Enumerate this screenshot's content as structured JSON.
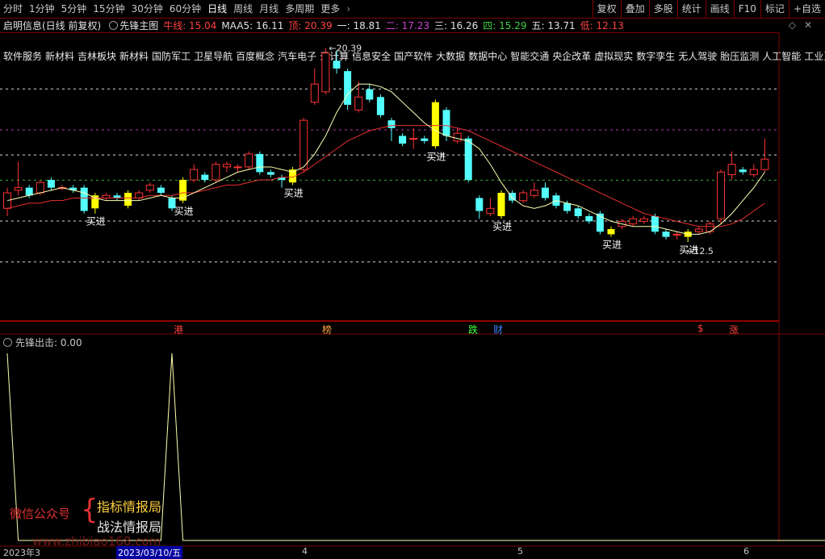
{
  "toolbar": {
    "timeframes": [
      "分时",
      "1分钟",
      "5分钟",
      "15分钟",
      "30分钟",
      "60分钟",
      "日线",
      "周线",
      "月线",
      "多周期",
      "更多"
    ],
    "more_arrow": "›",
    "active_index": 6,
    "right_tools": [
      "复权",
      "叠加",
      "多股",
      "统计",
      "画线",
      "F10",
      "标记",
      "+自选"
    ]
  },
  "info": {
    "stock": "启明信息(日线 前复权)",
    "indicator_name": "先锋主图",
    "items": [
      {
        "label": "牛线: ",
        "value": "15.04",
        "color": "#ff4040"
      },
      {
        "label": "MAA5: ",
        "value": "16.11",
        "color": "#e0e0e0"
      },
      {
        "label": "顶: ",
        "value": "20.39",
        "color": "#ff4040"
      },
      {
        "label": "一: ",
        "value": "18.81",
        "color": "#e0e0e0"
      },
      {
        "label": "二: ",
        "value": "17.23",
        "color": "#d040d0"
      },
      {
        "label": "三: ",
        "value": "16.26",
        "color": "#e0e0e0"
      },
      {
        "label": "四: ",
        "value": "15.29",
        "color": "#40d040"
      },
      {
        "label": "五: ",
        "value": "13.71",
        "color": "#e0e0e0"
      },
      {
        "label": "低: ",
        "value": "12.13",
        "color": "#ff4040"
      }
    ]
  },
  "concepts": [
    "软件服务",
    "新材料",
    "吉林板块",
    "新材料",
    "国防军工",
    "卫星导航",
    "百度概念",
    "汽车电子",
    "云计算",
    "信息安全",
    "国产软件",
    "大数据",
    "数据中心",
    "智能交通",
    "央企改革",
    "虚拟现实",
    "数字孪生",
    "无人驾驶",
    "胎压监测",
    "人工智能",
    "工业互联"
  ],
  "colors": {
    "up": "#ff3232",
    "down": "#54ffff",
    "signal": "#ffff00",
    "ma5": "#ffffb0",
    "ma": "#ff3a3a",
    "bg": "#000000"
  },
  "chart_data": [
    {
      "type": "candlestick",
      "title": "先锋主图",
      "ylim": [
        11.5,
        21.0
      ],
      "levels": [
        {
          "name": "顶",
          "value": 20.39,
          "color": "#ffffff"
        },
        {
          "name": "一",
          "value": 18.81,
          "color": "#ffffff"
        },
        {
          "name": "二",
          "value": 17.23,
          "color": "#d040d0"
        },
        {
          "name": "三",
          "value": 16.26,
          "color": "#ffffff"
        },
        {
          "name": "四",
          "value": 15.29,
          "color": "#40d040"
        },
        {
          "name": "五",
          "value": 13.71,
          "color": "#ffffff"
        },
        {
          "name": "低",
          "value": 12.13,
          "color": "#ffffff"
        }
      ],
      "high_label": "20.39",
      "low_label": "12.5",
      "candles": [
        {
          "o": 14.2,
          "c": 14.8,
          "h": 15.0,
          "l": 13.9,
          "s": 0
        },
        {
          "o": 14.9,
          "c": 15.0,
          "h": 16.0,
          "l": 14.7,
          "s": 0
        },
        {
          "o": 15.0,
          "c": 14.7,
          "h": 15.1,
          "l": 14.6,
          "s": 0
        },
        {
          "o": 14.8,
          "c": 15.2,
          "h": 15.3,
          "l": 14.7,
          "s": 0
        },
        {
          "o": 15.3,
          "c": 15.0,
          "h": 15.4,
          "l": 14.9,
          "s": 0
        },
        {
          "o": 15.0,
          "c": 15.0,
          "h": 15.1,
          "l": 14.9,
          "s": 0
        },
        {
          "o": 15.0,
          "c": 14.9,
          "h": 15.1,
          "l": 14.8,
          "s": 0
        },
        {
          "o": 15.0,
          "c": 14.1,
          "h": 15.1,
          "l": 14.0,
          "s": 0
        },
        {
          "o": 14.7,
          "c": 14.2,
          "h": 14.8,
          "l": 14.0,
          "s": 1
        },
        {
          "o": 14.6,
          "c": 14.7,
          "h": 14.8,
          "l": 14.5,
          "s": 0
        },
        {
          "o": 14.7,
          "c": 14.6,
          "h": 14.8,
          "l": 14.5,
          "s": 0
        },
        {
          "o": 14.8,
          "c": 14.3,
          "h": 14.9,
          "l": 14.2,
          "s": 1
        },
        {
          "o": 14.6,
          "c": 14.8,
          "h": 14.9,
          "l": 14.5,
          "s": 0
        },
        {
          "o": 14.9,
          "c": 15.1,
          "h": 15.2,
          "l": 14.8,
          "s": 0
        },
        {
          "o": 15.0,
          "c": 14.8,
          "h": 15.1,
          "l": 14.7,
          "s": 0
        },
        {
          "o": 14.6,
          "c": 14.2,
          "h": 14.7,
          "l": 14.1,
          "s": 0
        },
        {
          "o": 15.3,
          "c": 14.5,
          "h": 15.4,
          "l": 14.4,
          "s": 1
        },
        {
          "o": 15.3,
          "c": 15.7,
          "h": 15.9,
          "l": 15.2,
          "s": 0
        },
        {
          "o": 15.5,
          "c": 15.3,
          "h": 15.6,
          "l": 15.2,
          "s": 0
        },
        {
          "o": 15.3,
          "c": 15.9,
          "h": 16.0,
          "l": 15.2,
          "s": 0
        },
        {
          "o": 15.8,
          "c": 15.9,
          "h": 16.0,
          "l": 15.6,
          "s": 0
        },
        {
          "o": 15.8,
          "c": 15.8,
          "h": 15.9,
          "l": 15.6,
          "s": 0
        },
        {
          "o": 15.8,
          "c": 16.3,
          "h": 16.4,
          "l": 15.7,
          "s": 0
        },
        {
          "o": 16.3,
          "c": 15.6,
          "h": 16.4,
          "l": 15.5,
          "s": 0
        },
        {
          "o": 15.6,
          "c": 15.5,
          "h": 15.7,
          "l": 15.4,
          "s": 0
        },
        {
          "o": 15.4,
          "c": 15.3,
          "h": 15.5,
          "l": 15.0,
          "s": 0
        },
        {
          "o": 15.7,
          "c": 15.2,
          "h": 15.8,
          "l": 15.1,
          "s": 1
        },
        {
          "o": 15.7,
          "c": 17.6,
          "h": 17.7,
          "l": 15.6,
          "s": 0
        },
        {
          "o": 18.3,
          "c": 19.0,
          "h": 19.6,
          "l": 18.2,
          "s": 0
        },
        {
          "o": 18.7,
          "c": 20.2,
          "h": 20.39,
          "l": 18.6,
          "s": 0
        },
        {
          "o": 19.9,
          "c": 19.6,
          "h": 20.3,
          "l": 19.4,
          "s": 0
        },
        {
          "o": 19.5,
          "c": 18.2,
          "h": 19.6,
          "l": 18.0,
          "s": 0
        },
        {
          "o": 18.0,
          "c": 18.5,
          "h": 19.1,
          "l": 17.9,
          "s": 0
        },
        {
          "o": 18.8,
          "c": 18.4,
          "h": 19.0,
          "l": 18.3,
          "s": 0
        },
        {
          "o": 18.5,
          "c": 17.8,
          "h": 18.6,
          "l": 17.7,
          "s": 0
        },
        {
          "o": 17.6,
          "c": 17.3,
          "h": 17.7,
          "l": 16.8,
          "s": 0
        },
        {
          "o": 17.0,
          "c": 16.7,
          "h": 17.1,
          "l": 16.6,
          "s": 0
        },
        {
          "o": 16.9,
          "c": 16.9,
          "h": 17.3,
          "l": 16.5,
          "s": 0
        },
        {
          "o": 16.9,
          "c": 16.8,
          "h": 17.0,
          "l": 16.7,
          "s": 0
        },
        {
          "o": 18.3,
          "c": 16.6,
          "h": 18.4,
          "l": 16.5,
          "s": 1
        },
        {
          "o": 18.0,
          "c": 17.0,
          "h": 18.1,
          "l": 16.8,
          "s": 0
        },
        {
          "o": 16.8,
          "c": 17.1,
          "h": 17.3,
          "l": 16.7,
          "s": 0
        },
        {
          "o": 16.9,
          "c": 15.3,
          "h": 17.0,
          "l": 15.2,
          "s": 0
        },
        {
          "o": 14.6,
          "c": 14.1,
          "h": 14.7,
          "l": 13.8,
          "s": 0
        },
        {
          "o": 14.0,
          "c": 14.2,
          "h": 14.6,
          "l": 13.9,
          "s": 0
        },
        {
          "o": 14.8,
          "c": 13.9,
          "h": 14.9,
          "l": 13.8,
          "s": 1
        },
        {
          "o": 14.8,
          "c": 14.5,
          "h": 14.9,
          "l": 14.4,
          "s": 0
        },
        {
          "o": 14.5,
          "c": 14.8,
          "h": 14.9,
          "l": 14.4,
          "s": 0
        },
        {
          "o": 14.7,
          "c": 14.9,
          "h": 15.2,
          "l": 14.6,
          "s": 0
        },
        {
          "o": 15.0,
          "c": 14.6,
          "h": 15.2,
          "l": 14.5,
          "s": 0
        },
        {
          "o": 14.7,
          "c": 14.3,
          "h": 14.8,
          "l": 14.2,
          "s": 0
        },
        {
          "o": 14.4,
          "c": 14.1,
          "h": 14.5,
          "l": 14.0,
          "s": 0
        },
        {
          "o": 14.2,
          "c": 13.9,
          "h": 14.3,
          "l": 13.8,
          "s": 0
        },
        {
          "o": 13.9,
          "c": 13.7,
          "h": 14.0,
          "l": 13.6,
          "s": 0
        },
        {
          "o": 14.0,
          "c": 13.3,
          "h": 14.1,
          "l": 13.2,
          "s": 0
        },
        {
          "o": 13.4,
          "c": 13.2,
          "h": 13.5,
          "l": 13.1,
          "s": 1
        },
        {
          "o": 13.5,
          "c": 13.7,
          "h": 13.8,
          "l": 13.4,
          "s": 0
        },
        {
          "o": 13.6,
          "c": 13.8,
          "h": 13.9,
          "l": 13.5,
          "s": 0
        },
        {
          "o": 13.7,
          "c": 13.8,
          "h": 13.9,
          "l": 13.6,
          "s": 0
        },
        {
          "o": 13.9,
          "c": 13.3,
          "h": 14.0,
          "l": 13.2,
          "s": 0
        },
        {
          "o": 13.3,
          "c": 13.1,
          "h": 13.4,
          "l": 13.0,
          "s": 0
        },
        {
          "o": 13.2,
          "c": 13.2,
          "h": 13.3,
          "l": 13.0,
          "s": 0
        },
        {
          "o": 13.3,
          "c": 13.1,
          "h": 13.4,
          "l": 12.9,
          "s": 1
        },
        {
          "o": 13.3,
          "c": 13.4,
          "h": 13.5,
          "l": 13.2,
          "s": 0
        },
        {
          "o": 13.3,
          "c": 13.6,
          "h": 13.7,
          "l": 13.2,
          "s": 0
        },
        {
          "o": 13.8,
          "c": 15.6,
          "h": 15.7,
          "l": 13.6,
          "s": 0
        },
        {
          "o": 15.5,
          "c": 15.9,
          "h": 16.4,
          "l": 15.3,
          "s": 0
        },
        {
          "o": 15.7,
          "c": 15.6,
          "h": 15.8,
          "l": 15.5,
          "s": 0
        },
        {
          "o": 15.5,
          "c": 15.7,
          "h": 15.9,
          "l": 15.4,
          "s": 0
        },
        {
          "o": 15.7,
          "c": 16.1,
          "h": 16.9,
          "l": 15.6,
          "s": 0
        }
      ],
      "ma5": [
        14.5,
        14.6,
        14.7,
        14.8,
        14.9,
        15.0,
        14.9,
        14.8,
        14.6,
        14.5,
        14.5,
        14.5,
        14.5,
        14.6,
        14.7,
        14.6,
        14.6,
        14.8,
        15.0,
        15.2,
        15.4,
        15.6,
        15.7,
        15.8,
        15.8,
        15.7,
        15.6,
        15.8,
        16.3,
        17.0,
        17.9,
        18.6,
        19.0,
        19.0,
        18.9,
        18.7,
        18.3,
        17.9,
        17.5,
        17.2,
        17.0,
        16.9,
        16.8,
        16.5,
        15.9,
        15.2,
        14.6,
        14.3,
        14.2,
        14.3,
        14.5,
        14.4,
        14.3,
        14.1,
        13.9,
        13.7,
        13.6,
        13.5,
        13.5,
        13.5,
        13.4,
        13.3,
        13.2,
        13.2,
        13.3,
        13.6,
        14.0,
        14.5,
        15.0,
        15.6
      ],
      "ma": [
        14.2,
        14.3,
        14.4,
        14.4,
        14.5,
        14.5,
        14.6,
        14.6,
        14.6,
        14.6,
        14.6,
        14.6,
        14.6,
        14.7,
        14.7,
        14.7,
        14.8,
        14.8,
        14.9,
        15.0,
        15.1,
        15.1,
        15.2,
        15.3,
        15.3,
        15.4,
        15.4,
        15.6,
        15.9,
        16.2,
        16.5,
        16.8,
        17.0,
        17.2,
        17.3,
        17.4,
        17.4,
        17.4,
        17.4,
        17.4,
        17.4,
        17.3,
        17.2,
        17.0,
        16.8,
        16.6,
        16.4,
        16.2,
        16.0,
        15.8,
        15.6,
        15.4,
        15.2,
        15.0,
        14.8,
        14.6,
        14.4,
        14.2,
        14.0,
        13.9,
        13.8,
        13.7,
        13.6,
        13.5,
        13.5,
        13.5,
        13.6,
        13.8,
        14.1,
        14.4
      ],
      "buy_label": "买进",
      "buy_indices": [
        8,
        16,
        26,
        39,
        45,
        55,
        62
      ]
    },
    {
      "type": "line",
      "title": "先锋出击",
      "header": "先锋出击: 0.00",
      "ylim": [
        0,
        1
      ],
      "x": [
        "2023/03",
        "",
        "",
        "",
        "",
        "",
        "",
        "",
        "",
        "",
        "",
        "",
        "",
        "",
        "",
        "",
        "2023/03/10/五",
        "",
        "",
        "",
        "",
        "",
        "",
        "",
        "",
        "",
        "",
        "",
        "",
        "",
        "",
        "",
        "",
        "",
        "",
        "",
        "",
        "",
        "",
        "",
        "",
        "4",
        "",
        "",
        "",
        "",
        "",
        "",
        "",
        "",
        "",
        "",
        "",
        "",
        "",
        "",
        "",
        "",
        "",
        "",
        "",
        "5",
        "",
        "",
        "",
        "",
        "",
        "",
        "",
        "",
        "",
        "",
        "",
        "",
        "",
        "",
        "",
        "",
        "",
        "",
        "",
        "6",
        "",
        ""
      ],
      "values": [
        1,
        0,
        0,
        0,
        0,
        0,
        0,
        0,
        0,
        0,
        0,
        0,
        0,
        0,
        0,
        1,
        0,
        0,
        0,
        0,
        0,
        0,
        0,
        0,
        0,
        0,
        0,
        0,
        0,
        0,
        0,
        0,
        0,
        0,
        0,
        0,
        0,
        0,
        0,
        0,
        0,
        0,
        0,
        0,
        0,
        0,
        0,
        0,
        0,
        0,
        0,
        0,
        0,
        0,
        0,
        0,
        0,
        0,
        0,
        0,
        0,
        0,
        0,
        0,
        0,
        0,
        0,
        0,
        0,
        0,
        0,
        0,
        0,
        0,
        0,
        0,
        0,
        0,
        0,
        0,
        0,
        0,
        0,
        0,
        0,
        0,
        0
      ]
    }
  ],
  "news_markers": [
    {
      "text": "港",
      "color": "#ff4040",
      "pos": 0.21
    },
    {
      "text": "榜",
      "color": "#ffa040",
      "pos": 0.39
    },
    {
      "text": "跌",
      "color": "#40ff40",
      "pos": 0.568
    },
    {
      "text": "财",
      "color": "#4080ff",
      "pos": 0.598
    },
    {
      "text": "$",
      "color": "#ff4040",
      "pos": 0.845
    },
    {
      "text": "涨",
      "color": "#ff4040",
      "pos": 0.884
    }
  ],
  "watermark": {
    "left": "微信公众号",
    "brace": "{",
    "line1": "指标情报局",
    "line2": "战法情报局",
    "site": "www.zhibiao168.com"
  },
  "date_axis": {
    "start": "2023年3",
    "cursor": "2023/03/10/五",
    "m4": "4",
    "m5": "5",
    "m6": "6"
  }
}
